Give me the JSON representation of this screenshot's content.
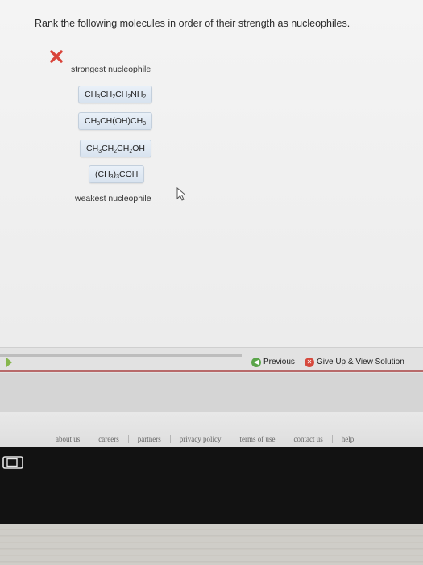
{
  "question": "Rank the following molecules in order of their strength as nucleophiles.",
  "status_icon": "wrong-x-icon",
  "labels": {
    "strongest": "strongest nucleophile",
    "weakest": "weakest nucleophile"
  },
  "molecules": [
    {
      "parts": [
        "CH",
        "3",
        "CH",
        "2",
        "CH",
        "2",
        "NH",
        "2"
      ]
    },
    {
      "parts": [
        "CH",
        "3",
        "CH(OH)CH",
        "3"
      ]
    },
    {
      "parts": [
        "CH",
        "3",
        "CH",
        "2",
        "CH",
        "2",
        "OH"
      ]
    },
    {
      "parts": [
        "(CH",
        "3",
        ")",
        "3",
        "COH"
      ]
    }
  ],
  "navigation": {
    "previous_label": "Previous",
    "giveup_label": "Give Up & View Solution"
  },
  "footer_links": [
    "about us",
    "careers",
    "partners",
    "privacy policy",
    "terms of use",
    "contact us",
    "help"
  ],
  "colors": {
    "wrong": "#d9443a",
    "previous_icon": "#5aa54a",
    "giveup_icon": "#d6493d",
    "chip_border": "#c3cfdc"
  }
}
